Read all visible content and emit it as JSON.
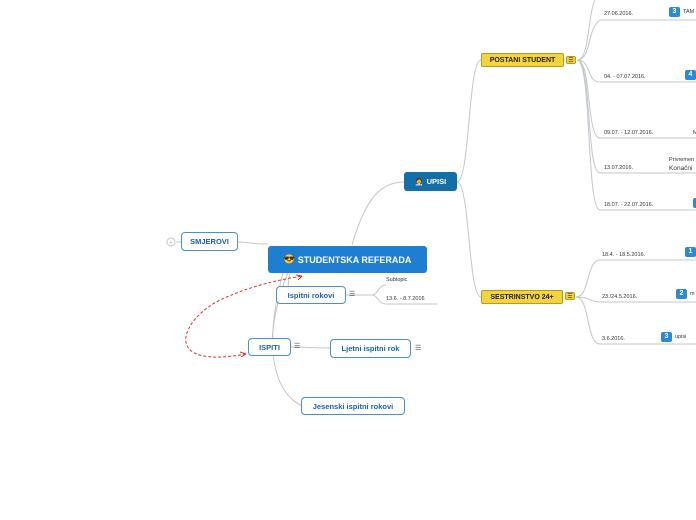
{
  "central": {
    "label": "STUDENTSKA REFERADA",
    "icon": "😎"
  },
  "smjerovi": {
    "label": "SMJEROVI"
  },
  "upisi": {
    "label": "UPISI",
    "icon": "🧑‍⚕️"
  },
  "ispitni_rokovi": {
    "label": "Ispitni rokovi"
  },
  "ispiti": {
    "label": "ISPITI"
  },
  "ljetni": {
    "label": "Ljetni ispitni rok"
  },
  "jesenski": {
    "label": "Jesenski ispitni rokovi"
  },
  "subtopic": {
    "subtopic": "Subtopic",
    "date": "13.6. - 8.7.2016"
  },
  "postani": {
    "label": "POSTANI STUDENT",
    "items": [
      {
        "date": "27.06.2016.",
        "badge": "3",
        "text": "TAM"
      },
      {
        "date": "04. - 07.07.2016.",
        "badge": "4",
        "text": ""
      },
      {
        "date": "09.07. - 12.07.2016.",
        "badge": "",
        "text": "M"
      },
      {
        "date": "13.07.2016.",
        "badge": "",
        "text": "Privremen",
        "text2": "Konačni"
      },
      {
        "date": "18.07. - 22.07.2016.",
        "badge": "",
        "text": ""
      }
    ]
  },
  "sestrinstvo": {
    "label": "SESTRINSTVO 24+",
    "items": [
      {
        "date": "18.4. - 18.5.2016.",
        "badge": "1",
        "text": ""
      },
      {
        "date": "23./24.5.2016.",
        "badge": "2",
        "text": "m"
      },
      {
        "date": "3.6.2016.",
        "badge": "3",
        "text": "upisi"
      }
    ]
  },
  "menu_glyph": "☰"
}
